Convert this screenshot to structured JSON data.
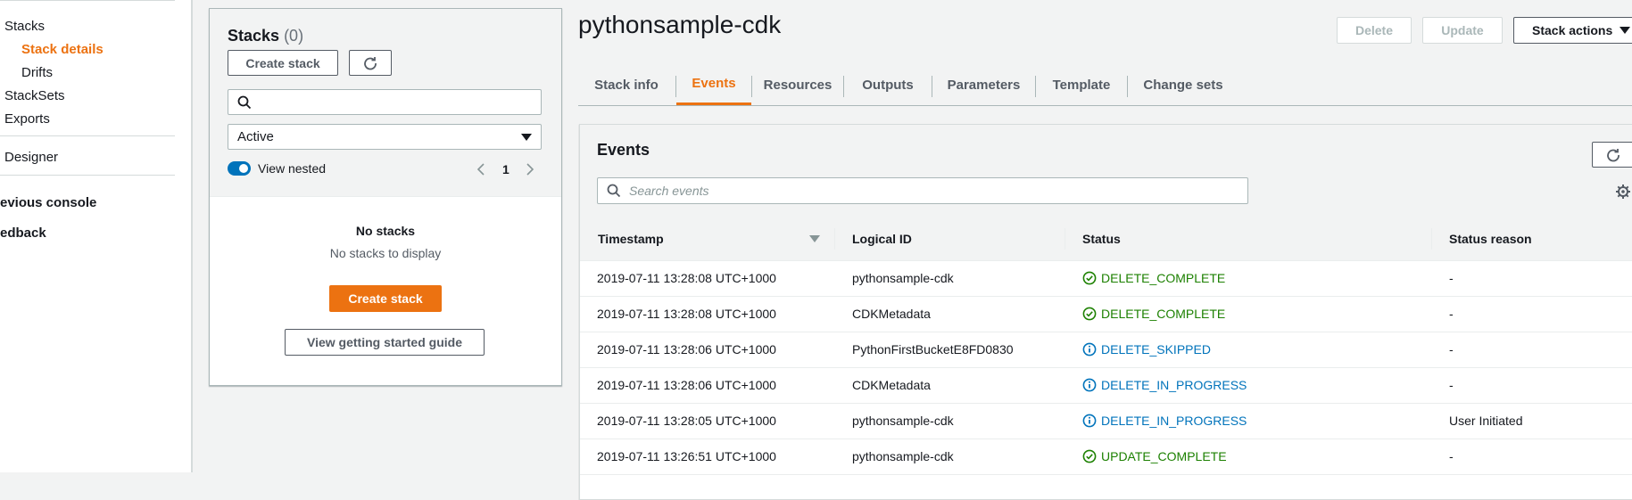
{
  "nav": {
    "stacks": "Stacks",
    "stack_details": "Stack details",
    "drifts": "Drifts",
    "stacksets": "StackSets",
    "exports": "Exports",
    "designer": "Designer",
    "previous_console": "evious console",
    "feedback": "edback"
  },
  "panel": {
    "title": "Stacks",
    "count": "(0)",
    "create_stack": "Create stack",
    "filter_value": "Active",
    "view_nested": "View nested",
    "page": "1",
    "empty_title": "No stacks",
    "empty_sub": "No stacks to display",
    "create_primary": "Create stack",
    "guide": "View getting started guide"
  },
  "main": {
    "title": "pythonsample-cdk",
    "delete": "Delete",
    "update": "Update",
    "stack_actions": "Stack actions",
    "tabs": [
      "Stack info",
      "Events",
      "Resources",
      "Outputs",
      "Parameters",
      "Template",
      "Change sets"
    ]
  },
  "events": {
    "title": "Events",
    "search_placeholder": "Search events",
    "columns": [
      "Timestamp",
      "Logical ID",
      "Status",
      "Status reason"
    ],
    "rows": [
      {
        "timestamp": "2019-07-11 13:28:08 UTC+1000",
        "logical_id": "pythonsample-cdk",
        "status": "DELETE_COMPLETE",
        "reason": "-"
      },
      {
        "timestamp": "2019-07-11 13:28:08 UTC+1000",
        "logical_id": "CDKMetadata",
        "status": "DELETE_COMPLETE",
        "reason": "-"
      },
      {
        "timestamp": "2019-07-11 13:28:06 UTC+1000",
        "logical_id": "PythonFirstBucketE8FD0830",
        "status": "DELETE_SKIPPED",
        "reason": "-"
      },
      {
        "timestamp": "2019-07-11 13:28:06 UTC+1000",
        "logical_id": "CDKMetadata",
        "status": "DELETE_IN_PROGRESS",
        "reason": "-"
      },
      {
        "timestamp": "2019-07-11 13:28:05 UTC+1000",
        "logical_id": "pythonsample-cdk",
        "status": "DELETE_IN_PROGRESS",
        "reason": "User Initiated"
      },
      {
        "timestamp": "2019-07-11 13:26:51 UTC+1000",
        "logical_id": "pythonsample-cdk",
        "status": "UPDATE_COMPLETE",
        "reason": "-"
      }
    ]
  },
  "colors": {
    "accent": "#ec7211",
    "success": "#1d8102",
    "info": "#0073bb"
  }
}
